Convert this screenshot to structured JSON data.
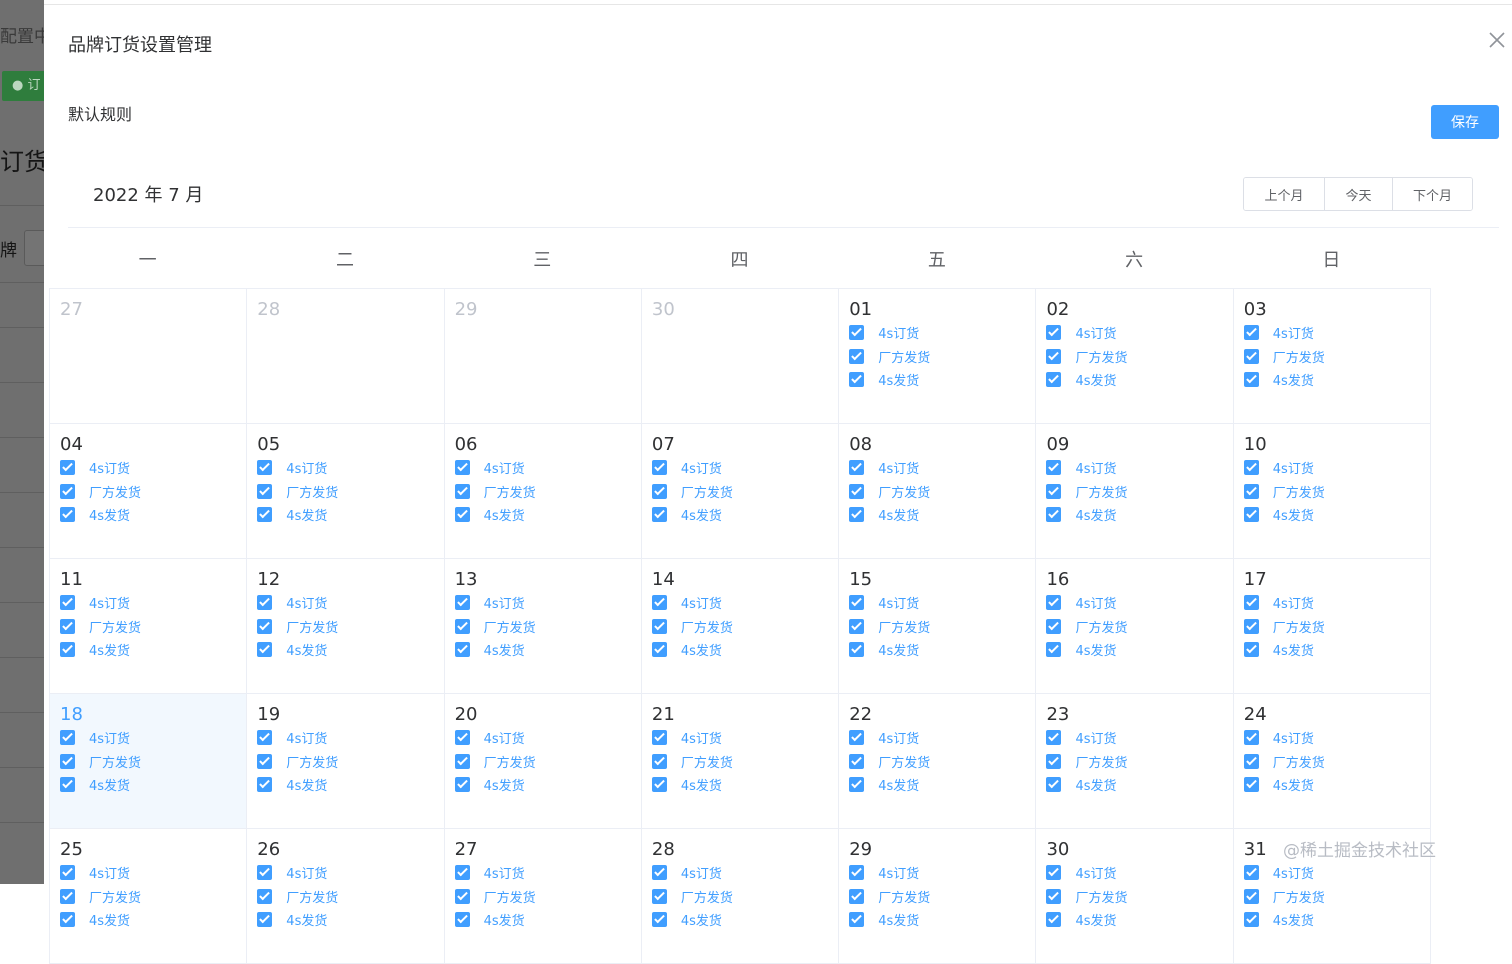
{
  "background": {
    "title": "配置中",
    "tag_label": "● 订",
    "heading": "订货",
    "filter_label": "牌"
  },
  "dialog": {
    "title": "品牌订货设置管理",
    "rule_label": "默认规则",
    "save_label": "保存"
  },
  "calendar": {
    "title": "2022 年 7 月",
    "nav": {
      "prev": "上个月",
      "today": "今天",
      "next": "下个月"
    },
    "weekdays": [
      "一",
      "二",
      "三",
      "四",
      "五",
      "六",
      "日"
    ],
    "options": [
      "4s订货",
      "厂方发货",
      "4s发货"
    ],
    "today_day": "18",
    "weeks": [
      [
        {
          "day": "27",
          "other": true
        },
        {
          "day": "28",
          "other": true
        },
        {
          "day": "29",
          "other": true
        },
        {
          "day": "30",
          "other": true
        },
        {
          "day": "01"
        },
        {
          "day": "02"
        },
        {
          "day": "03"
        }
      ],
      [
        {
          "day": "04"
        },
        {
          "day": "05"
        },
        {
          "day": "06"
        },
        {
          "day": "07"
        },
        {
          "day": "08"
        },
        {
          "day": "09"
        },
        {
          "day": "10"
        }
      ],
      [
        {
          "day": "11"
        },
        {
          "day": "12"
        },
        {
          "day": "13"
        },
        {
          "day": "14"
        },
        {
          "day": "15"
        },
        {
          "day": "16"
        },
        {
          "day": "17"
        }
      ],
      [
        {
          "day": "18",
          "today": true
        },
        {
          "day": "19"
        },
        {
          "day": "20"
        },
        {
          "day": "21"
        },
        {
          "day": "22"
        },
        {
          "day": "23"
        },
        {
          "day": "24"
        }
      ],
      [
        {
          "day": "25"
        },
        {
          "day": "26"
        },
        {
          "day": "27"
        },
        {
          "day": "28"
        },
        {
          "day": "29"
        },
        {
          "day": "30"
        },
        {
          "day": "31"
        }
      ]
    ]
  },
  "watermark": "@稀土掘金技术社区",
  "colors": {
    "primary": "#409eff",
    "today_bg": "#f2f8fe",
    "border": "#ebeef5"
  },
  "icons": {
    "close": "close-icon",
    "checkbox": "checkbox-checked-icon"
  }
}
